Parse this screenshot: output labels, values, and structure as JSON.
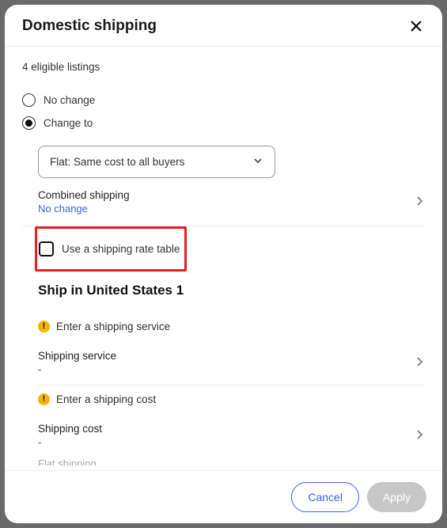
{
  "header": {
    "title": "Domestic shipping"
  },
  "eligible_text": "4 eligible listings",
  "radios": {
    "no_change": "No change",
    "change_to": "Change to"
  },
  "select": {
    "value": "Flat: Same cost to all buyers"
  },
  "combined": {
    "label": "Combined shipping",
    "value": "No change"
  },
  "rate_table": {
    "label": "Use a shipping rate table"
  },
  "section": {
    "title": "Ship in United States 1"
  },
  "warn_service": "Enter a shipping service",
  "shipping_service": {
    "label": "Shipping service",
    "value": "-"
  },
  "warn_cost": "Enter a shipping cost",
  "shipping_cost": {
    "label": "Shipping cost",
    "value": "-"
  },
  "cutoff": "Flat shipping",
  "footer": {
    "cancel": "Cancel",
    "apply": "Apply"
  }
}
